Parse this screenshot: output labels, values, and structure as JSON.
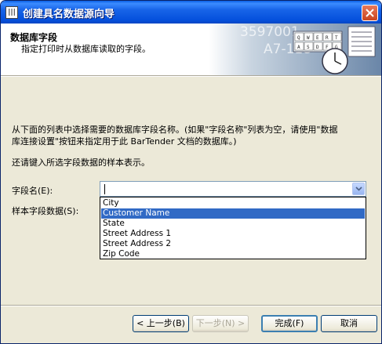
{
  "window": {
    "title": "创建具名数据源向导",
    "app_icon": "bartender-app-icon",
    "close_icon": "close-icon"
  },
  "header": {
    "title": "数据库字段",
    "subtitle": "指定打印时从数据库读取的字段。",
    "art_numbers": [
      "3597001",
      "A7-118"
    ],
    "keyboard_keys": [
      "Q",
      "W",
      "E",
      "R",
      "T",
      "A",
      "S",
      "D",
      "F",
      "G"
    ]
  },
  "body": {
    "description_line1": "从下面的列表中选择需要的数据库字段名称。(如果\"字段名称\"列表为空，请使用\"数据",
    "description_line2": "库连接设置\"按钮来指定用于此 BarTender 文档的数据库。)",
    "sample_note": "还请键入所选字段数据的样本表示。",
    "field_label": "字段名(E):",
    "sample_label": "样本字段数据(S):",
    "field_value": "",
    "options": [
      "City",
      "Customer Name",
      "State",
      "Street Address 1",
      "Street Address 2",
      "Zip Code"
    ],
    "highlighted_option": "Customer Name"
  },
  "buttons": {
    "back": "< 上一步(B)",
    "next": "下一步(N) >",
    "finish": "完成(F)",
    "cancel": "取消"
  },
  "colors": {
    "title_bar": "#0a5fe6",
    "close_button": "#d6542e",
    "selection": "#316ac5",
    "dialog_bg": "#ece9d8"
  }
}
